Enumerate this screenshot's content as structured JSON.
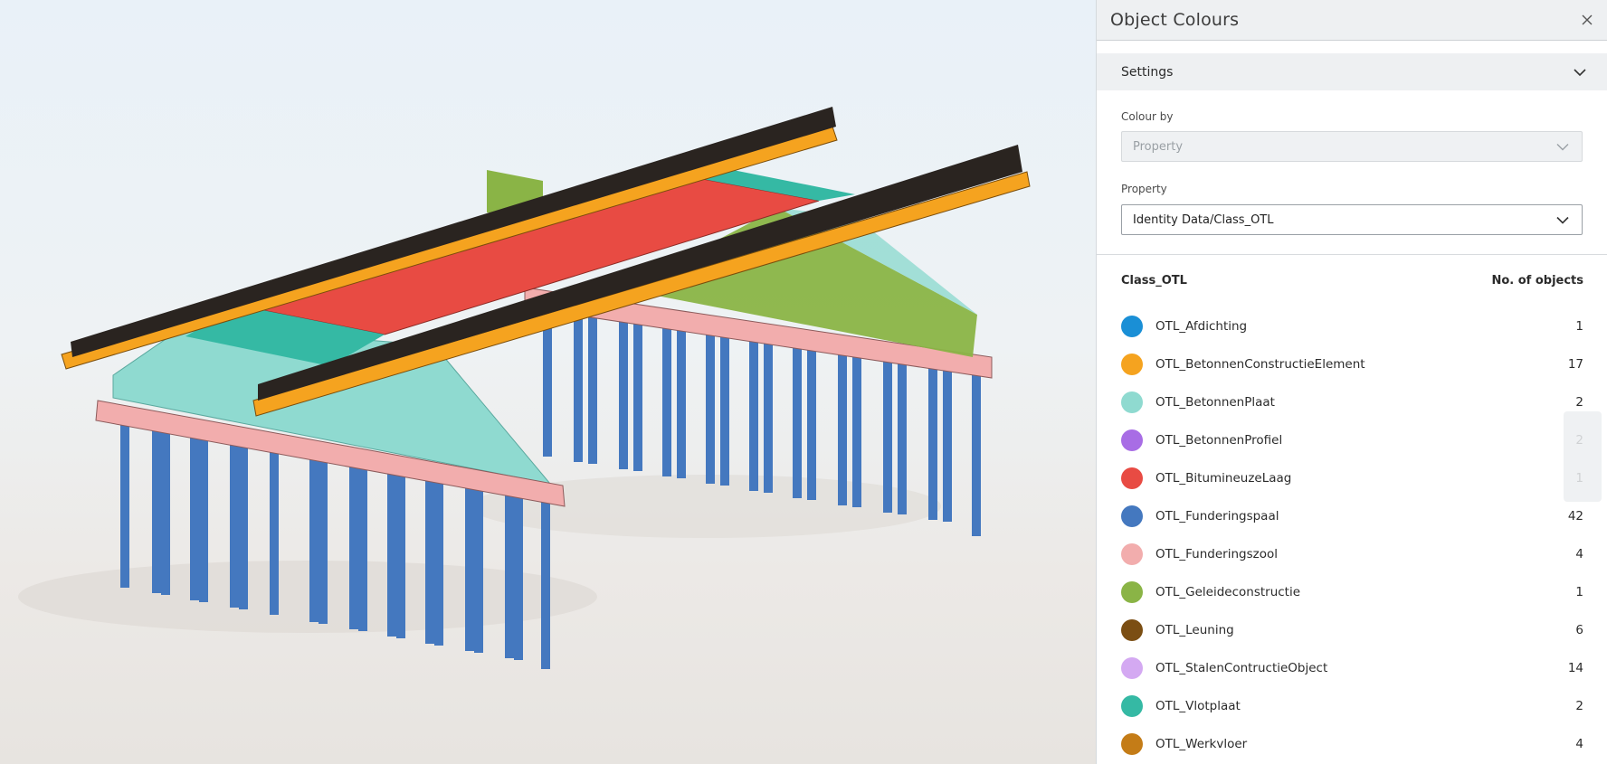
{
  "panel": {
    "title": "Object Colours",
    "settings_label": "Settings",
    "colour_by_label": "Colour by",
    "colour_by_value": "Property",
    "property_label": "Property",
    "property_value": "Identity Data/Class_OTL",
    "list_header_class": "Class_OTL",
    "list_header_count": "No. of objects",
    "items": [
      {
        "label": "OTL_Afdichting",
        "count": "1",
        "color": "#1a8fd6"
      },
      {
        "label": "OTL_BetonnenConstructieElement",
        "count": "17",
        "color": "#f5a31f"
      },
      {
        "label": "OTL_BetonnenPlaat",
        "count": "2",
        "color": "#8fdad0"
      },
      {
        "label": "OTL_BetonnenProfiel",
        "count": "2",
        "color": "#a86de5"
      },
      {
        "label": "OTL_BitumineuzeLaag",
        "count": "1",
        "color": "#e84b43"
      },
      {
        "label": "OTL_Funderingspaal",
        "count": "42",
        "color": "#4478bf"
      },
      {
        "label": "OTL_Funderingszool",
        "count": "4",
        "color": "#f2adad"
      },
      {
        "label": "OTL_Geleideconstructie",
        "count": "1",
        "color": "#8ab446"
      },
      {
        "label": "OTL_Leuning",
        "count": "6",
        "color": "#7b4e13"
      },
      {
        "label": "OTL_StalenContructieObject",
        "count": "14",
        "color": "#d4a9f2"
      },
      {
        "label": "OTL_Vlotplaat",
        "count": "2",
        "color": "#35b9a4"
      },
      {
        "label": "OTL_Werkvloer",
        "count": "4",
        "color": "#c47c17"
      }
    ]
  },
  "icons": {
    "close": "close-icon",
    "chevron": "chevron-down-icon"
  }
}
